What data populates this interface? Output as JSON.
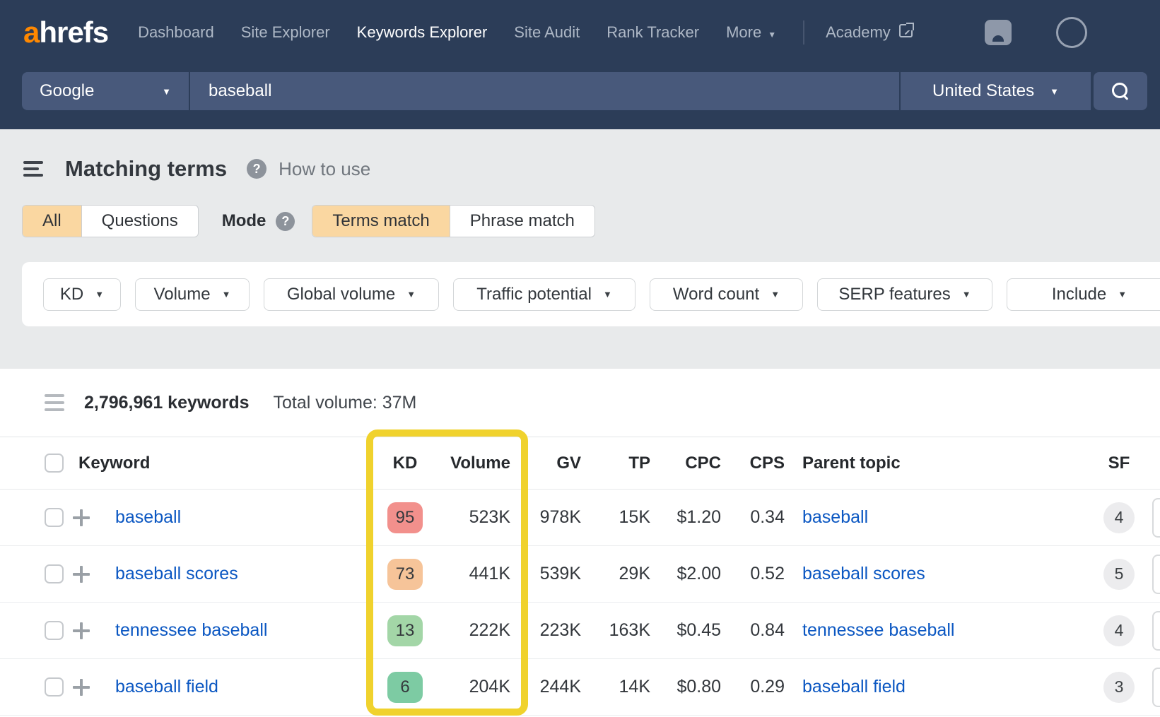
{
  "nav": {
    "logo_accent": "a",
    "logo_rest": "hrefs",
    "items": [
      {
        "label": "Dashboard",
        "active": false
      },
      {
        "label": "Site Explorer",
        "active": false
      },
      {
        "label": "Keywords Explorer",
        "active": true
      },
      {
        "label": "Site Audit",
        "active": false
      },
      {
        "label": "Rank Tracker",
        "active": false
      },
      {
        "label": "More",
        "active": false
      }
    ],
    "academy_label": "Academy"
  },
  "search": {
    "engine": "Google",
    "query": "baseball",
    "country": "United States"
  },
  "page_header": {
    "title": "Matching terms",
    "help_link": "How to use"
  },
  "tabs": {
    "all": "All",
    "questions": "Questions",
    "mode_label": "Mode",
    "terms_match": "Terms match",
    "phrase_match": "Phrase match"
  },
  "filters": [
    "KD",
    "Volume",
    "Global volume",
    "Traffic potential",
    "Word count",
    "SERP features",
    "Include"
  ],
  "results": {
    "keyword_count": "2,796,961 keywords",
    "total_volume": "Total volume: 37M"
  },
  "table": {
    "headers": [
      "Keyword",
      "KD",
      "Volume",
      "GV",
      "TP",
      "CPC",
      "CPS",
      "Parent topic",
      "SF"
    ],
    "rows": [
      {
        "keyword": "baseball",
        "kd": "95",
        "kd_color": "#f2908c",
        "volume": "523K",
        "gv": "978K",
        "tp": "15K",
        "cpc": "$1.20",
        "cps": "0.34",
        "parent": "baseball",
        "sf": "4"
      },
      {
        "keyword": "baseball scores",
        "kd": "73",
        "kd_color": "#f6c499",
        "volume": "441K",
        "gv": "539K",
        "tp": "29K",
        "cpc": "$2.00",
        "cps": "0.52",
        "parent": "baseball scores",
        "sf": "5"
      },
      {
        "keyword": "tennessee baseball",
        "kd": "13",
        "kd_color": "#a3d6a7",
        "volume": "222K",
        "gv": "223K",
        "tp": "163K",
        "cpc": "$0.45",
        "cps": "0.84",
        "parent": "tennessee baseball",
        "sf": "4"
      },
      {
        "keyword": "baseball field",
        "kd": "6",
        "kd_color": "#7dcba3",
        "volume": "204K",
        "gv": "244K",
        "tp": "14K",
        "cpc": "$0.80",
        "cps": "0.29",
        "parent": "baseball field",
        "sf": "3"
      }
    ]
  },
  "icons": {
    "caret_down": "▼",
    "help": "?"
  },
  "colors": {
    "brand_orange": "#ff8800",
    "header_navy": "#2c3d58",
    "highlight_yellow": "#f0d22d",
    "tab_active_bg": "#fad7a1",
    "link_blue": "#0b57c2"
  }
}
